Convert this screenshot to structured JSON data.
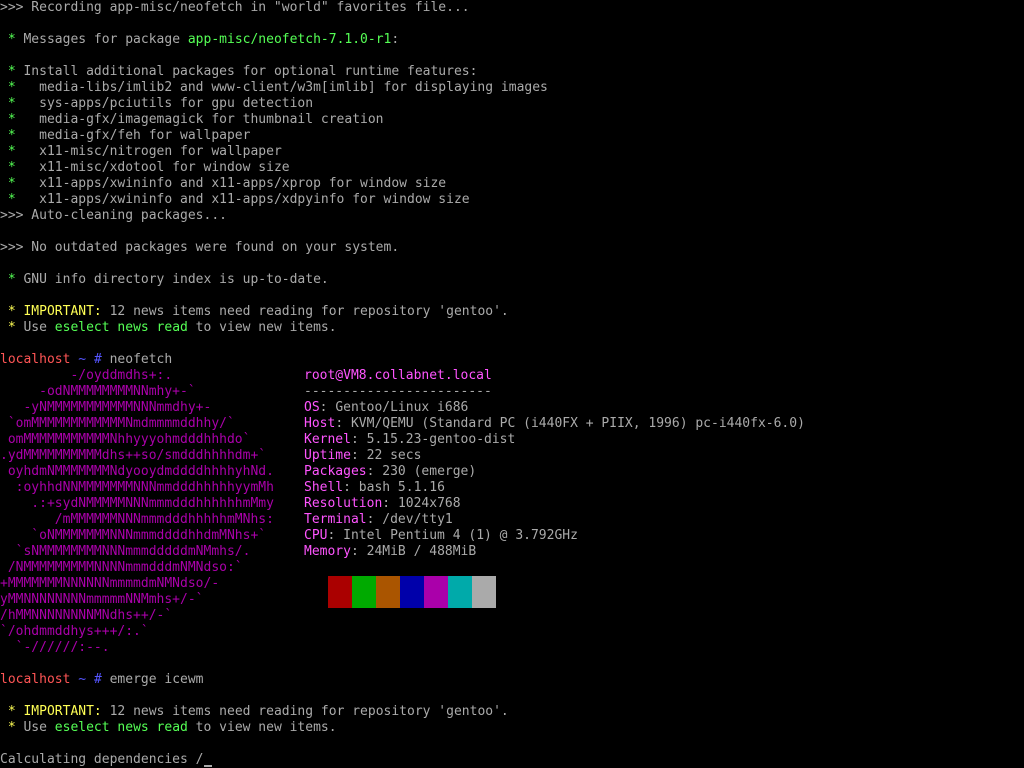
{
  "terminal": {
    "pre": [
      ">>> Recording app-misc/neofetch in \"world\" favorites file...",
      "",
      "Messages for package ",
      "app-misc/neofetch-7.1.0-r1",
      ":",
      "Install additional packages for optional runtime features:",
      "  media-libs/imlib2 and www-client/w3m[imlib] for displaying images",
      "  sys-apps/pciutils for gpu detection",
      "  media-gfx/imagemagick for thumbnail creation",
      "  media-gfx/feh for wallpaper",
      "  x11-misc/nitrogen for wallpaper",
      "  x11-misc/xdotool for window size",
      "  x11-apps/xwininfo and x11-apps/xprop for window size",
      "  x11-apps/xwininfo and x11-apps/xdpyinfo for window size",
      ">>> Auto-cleaning packages...",
      ">>> No outdated packages were found on your system.",
      "GNU info directory index is up-to-date."
    ],
    "news": {
      "important_label": "IMPORTANT:",
      "important_text": " 12 news items need reading for repository 'gentoo'.",
      "use_text": "Use ",
      "eselect_cmd": "eselect news read",
      "view_text": " to view new items."
    },
    "star": "*",
    "prompt": {
      "host": "localhost",
      "dir": "~",
      "hash": "#"
    },
    "commands": {
      "first": "neofetch",
      "second": "emerge icewm"
    },
    "final_line": "Calculating dependencies /"
  },
  "neofetch": {
    "art": [
      "         -/oyddmdhs+:.",
      "     -odNMMMMMMMMNNmhy+-`",
      "   -yNMMMMMMMMMMMNNNmmdhy+-",
      " `omMMMMMMMMMMMMNmdmmmmddhhy/`",
      " omMMMMMMMMMMMNhhyyyohmdddhhhdo`",
      ".ydMMMMMMMMMMdhs++so/smdddhhhhdm+`",
      " oyhdmNMMMMMMMNdyooydmddddhhhhyhNd.",
      "  :oyhhdNNMMMMMMMNNNmmdddhhhhhyymMh",
      "    .:+sydNMMMMMNNNmmmdddhhhhhhmMmy",
      "       /mMMMMMMNNNmmmdddhhhhhmMNhs:",
      "    `oNMMMMMMMNNNmmmddddhhdmMNhs+`",
      "  `sNMMMMMMMMNNNmmmdddddmNMmhs/.",
      " /NMMMMMMMMMNNNNmmmdddmNMNdso:`",
      "+MMMMMMMNNNNNNmmmmdmNMNdso/-",
      "yMMNNNNNNNNmmmmmNNMmhs+/-`",
      "/hMMNNNNNNNNMNdhs++/-`",
      "`/ohdmmddhys+++/:.`",
      "  `-//////:--."
    ],
    "user_host": "root@VM8.collabnet.local",
    "separator": "------------------------",
    "info": [
      {
        "key": "OS",
        "value": "Gentoo/Linux i686"
      },
      {
        "key": "Host",
        "value": "KVM/QEMU (Standard PC (i440FX + PIIX, 1996) pc-i440fx-6.0)"
      },
      {
        "key": "Kernel",
        "value": "5.15.23-gentoo-dist"
      },
      {
        "key": "Uptime",
        "value": "22 secs"
      },
      {
        "key": "Packages",
        "value": "230 (emerge)"
      },
      {
        "key": "Shell",
        "value": "bash 5.1.16"
      },
      {
        "key": "Resolution",
        "value": "1024x768"
      },
      {
        "key": "Terminal",
        "value": "/dev/tty1"
      },
      {
        "key": "CPU",
        "value": "Intel Pentium 4 (1) @ 3.792GHz"
      },
      {
        "key": "Memory",
        "value": "24MiB / 488MiB"
      }
    ],
    "colon": ": ",
    "palette": [
      "#aa0000",
      "#00aa00",
      "#aa5500",
      "#0000aa",
      "#aa00aa",
      "#00aaaa",
      "#aaaaaa"
    ]
  }
}
